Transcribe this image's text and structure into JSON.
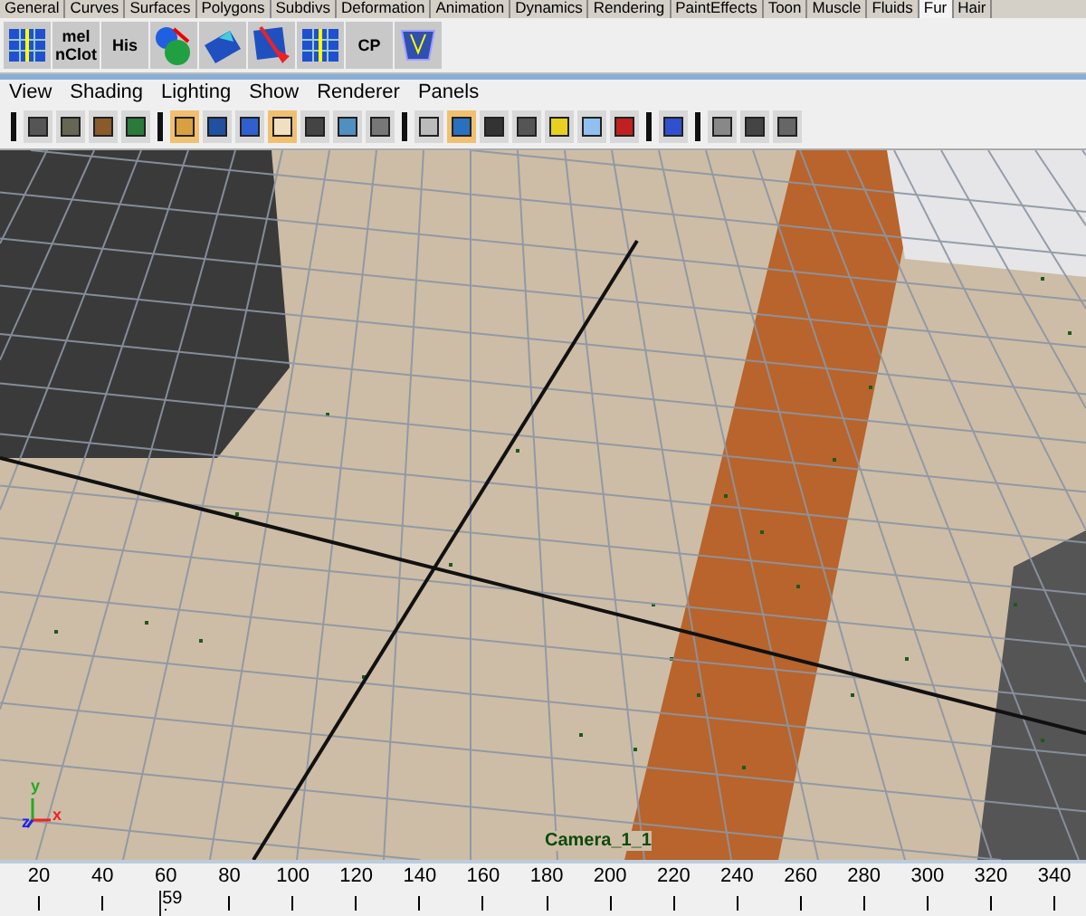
{
  "shelf_tabs": [
    {
      "label": "General",
      "selected": false
    },
    {
      "label": "Curves",
      "selected": false
    },
    {
      "label": "Surfaces",
      "selected": false
    },
    {
      "label": "Polygons",
      "selected": false
    },
    {
      "label": "Subdivs",
      "selected": false
    },
    {
      "label": "Deformation",
      "selected": false
    },
    {
      "label": "Animation",
      "selected": false
    },
    {
      "label": "Dynamics",
      "selected": false
    },
    {
      "label": "Rendering",
      "selected": false
    },
    {
      "label": "PaintEffects",
      "selected": false
    },
    {
      "label": "Toon",
      "selected": false
    },
    {
      "label": "Muscle",
      "selected": false
    },
    {
      "label": "Fluids",
      "selected": false
    },
    {
      "label": "Fur",
      "selected": true
    },
    {
      "label": "Hair",
      "selected": false
    }
  ],
  "shelf": [
    {
      "kind": "grid"
    },
    {
      "kind": "text",
      "lines": [
        "mel",
        "nClot"
      ]
    },
    {
      "kind": "text",
      "lines": [
        "His"
      ]
    },
    {
      "kind": "spheres"
    },
    {
      "kind": "plane"
    },
    {
      "kind": "cursor"
    },
    {
      "kind": "grid"
    },
    {
      "kind": "text",
      "lines": [
        "CP"
      ]
    },
    {
      "kind": "mesh"
    }
  ],
  "panel_menu": [
    "View",
    "Shading",
    "Lighting",
    "Show",
    "Renderer",
    "Panels"
  ],
  "toolbar": [
    {
      "kind": "separator"
    },
    {
      "kind": "button",
      "selected": false
    },
    {
      "kind": "button",
      "selected": false
    },
    {
      "kind": "button",
      "selected": false
    },
    {
      "kind": "button",
      "selected": false
    },
    {
      "kind": "separator"
    },
    {
      "kind": "button",
      "selected": true
    },
    {
      "kind": "button",
      "selected": false
    },
    {
      "kind": "button",
      "selected": false
    },
    {
      "kind": "button",
      "selected": true
    },
    {
      "kind": "button",
      "selected": false
    },
    {
      "kind": "button",
      "selected": false
    },
    {
      "kind": "button",
      "selected": false
    },
    {
      "kind": "separator"
    },
    {
      "kind": "button",
      "selected": false
    },
    {
      "kind": "button",
      "selected": true
    },
    {
      "kind": "button",
      "selected": false
    },
    {
      "kind": "button",
      "selected": false
    },
    {
      "kind": "button",
      "selected": false
    },
    {
      "kind": "button",
      "selected": false
    },
    {
      "kind": "button",
      "selected": false
    },
    {
      "kind": "separator"
    },
    {
      "kind": "button",
      "selected": false
    },
    {
      "kind": "separator"
    },
    {
      "kind": "button",
      "selected": false
    },
    {
      "kind": "button",
      "selected": false
    },
    {
      "kind": "button",
      "selected": false
    }
  ],
  "viewport": {
    "camera_label": "Camera_1_1",
    "axes": [
      "x",
      "y",
      "z"
    ]
  },
  "timeline": {
    "ticks": [
      "20",
      "40",
      "60",
      "80",
      "100",
      "120",
      "140",
      "160",
      "180",
      "200",
      "220",
      "240",
      "260",
      "280",
      "300",
      "320",
      "340"
    ],
    "current_frame": "59",
    "level": 0.146
  }
}
